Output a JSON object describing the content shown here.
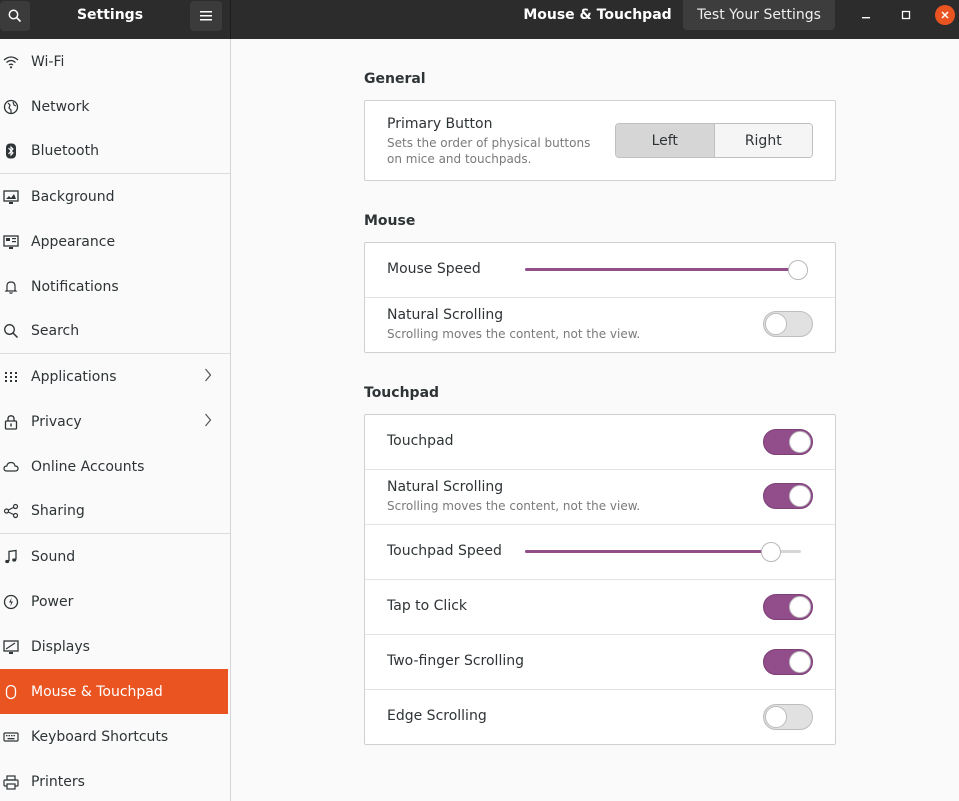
{
  "window": {
    "left_title": "Settings",
    "main_title": "Mouse & Touchpad",
    "test_button": "Test Your Settings"
  },
  "sidebar": {
    "items": [
      {
        "label": "Wi-Fi",
        "icon": "wifi-icon"
      },
      {
        "label": "Network",
        "icon": "network-icon"
      },
      {
        "label": "Bluetooth",
        "icon": "bluetooth-icon"
      },
      {
        "label": "Background",
        "icon": "background-icon"
      },
      {
        "label": "Appearance",
        "icon": "appearance-icon"
      },
      {
        "label": "Notifications",
        "icon": "bell-icon"
      },
      {
        "label": "Search",
        "icon": "search-icon"
      },
      {
        "label": "Applications",
        "icon": "apps-grid-icon"
      },
      {
        "label": "Privacy",
        "icon": "lock-icon"
      },
      {
        "label": "Online Accounts",
        "icon": "cloud-icon"
      },
      {
        "label": "Sharing",
        "icon": "share-icon"
      },
      {
        "label": "Sound",
        "icon": "music-note-icon"
      },
      {
        "label": "Power",
        "icon": "power-icon"
      },
      {
        "label": "Displays",
        "icon": "display-icon"
      },
      {
        "label": "Mouse & Touchpad",
        "icon": "mouse-icon"
      },
      {
        "label": "Keyboard Shortcuts",
        "icon": "keyboard-icon"
      },
      {
        "label": "Printers",
        "icon": "printer-icon"
      }
    ]
  },
  "general": {
    "title": "General",
    "primary_button": {
      "title": "Primary Button",
      "subtitle_line1": "Sets the order of physical buttons",
      "subtitle_line2": "on mice and touchpads.",
      "left": "Left",
      "right": "Right",
      "selected": "Left"
    }
  },
  "mouse": {
    "title": "Mouse",
    "speed_label": "Mouse Speed",
    "speed_value": 0.99,
    "natural_title": "Natural Scrolling",
    "natural_sub": "Scrolling moves the content, not the view.",
    "natural_on": false
  },
  "touchpad": {
    "title": "Touchpad",
    "touchpad_label": "Touchpad",
    "touchpad_on": true,
    "natural_title": "Natural Scrolling",
    "natural_sub": "Scrolling moves the content, not the view.",
    "natural_on": true,
    "speed_label": "Touchpad Speed",
    "speed_value": 0.89,
    "tap_label": "Tap to Click",
    "tap_on": true,
    "twofinger_label": "Two-finger Scrolling",
    "twofinger_on": true,
    "edge_label": "Edge Scrolling",
    "edge_on": false
  },
  "colors": {
    "accent": "#e95420",
    "toggle_on": "#924d8b"
  }
}
